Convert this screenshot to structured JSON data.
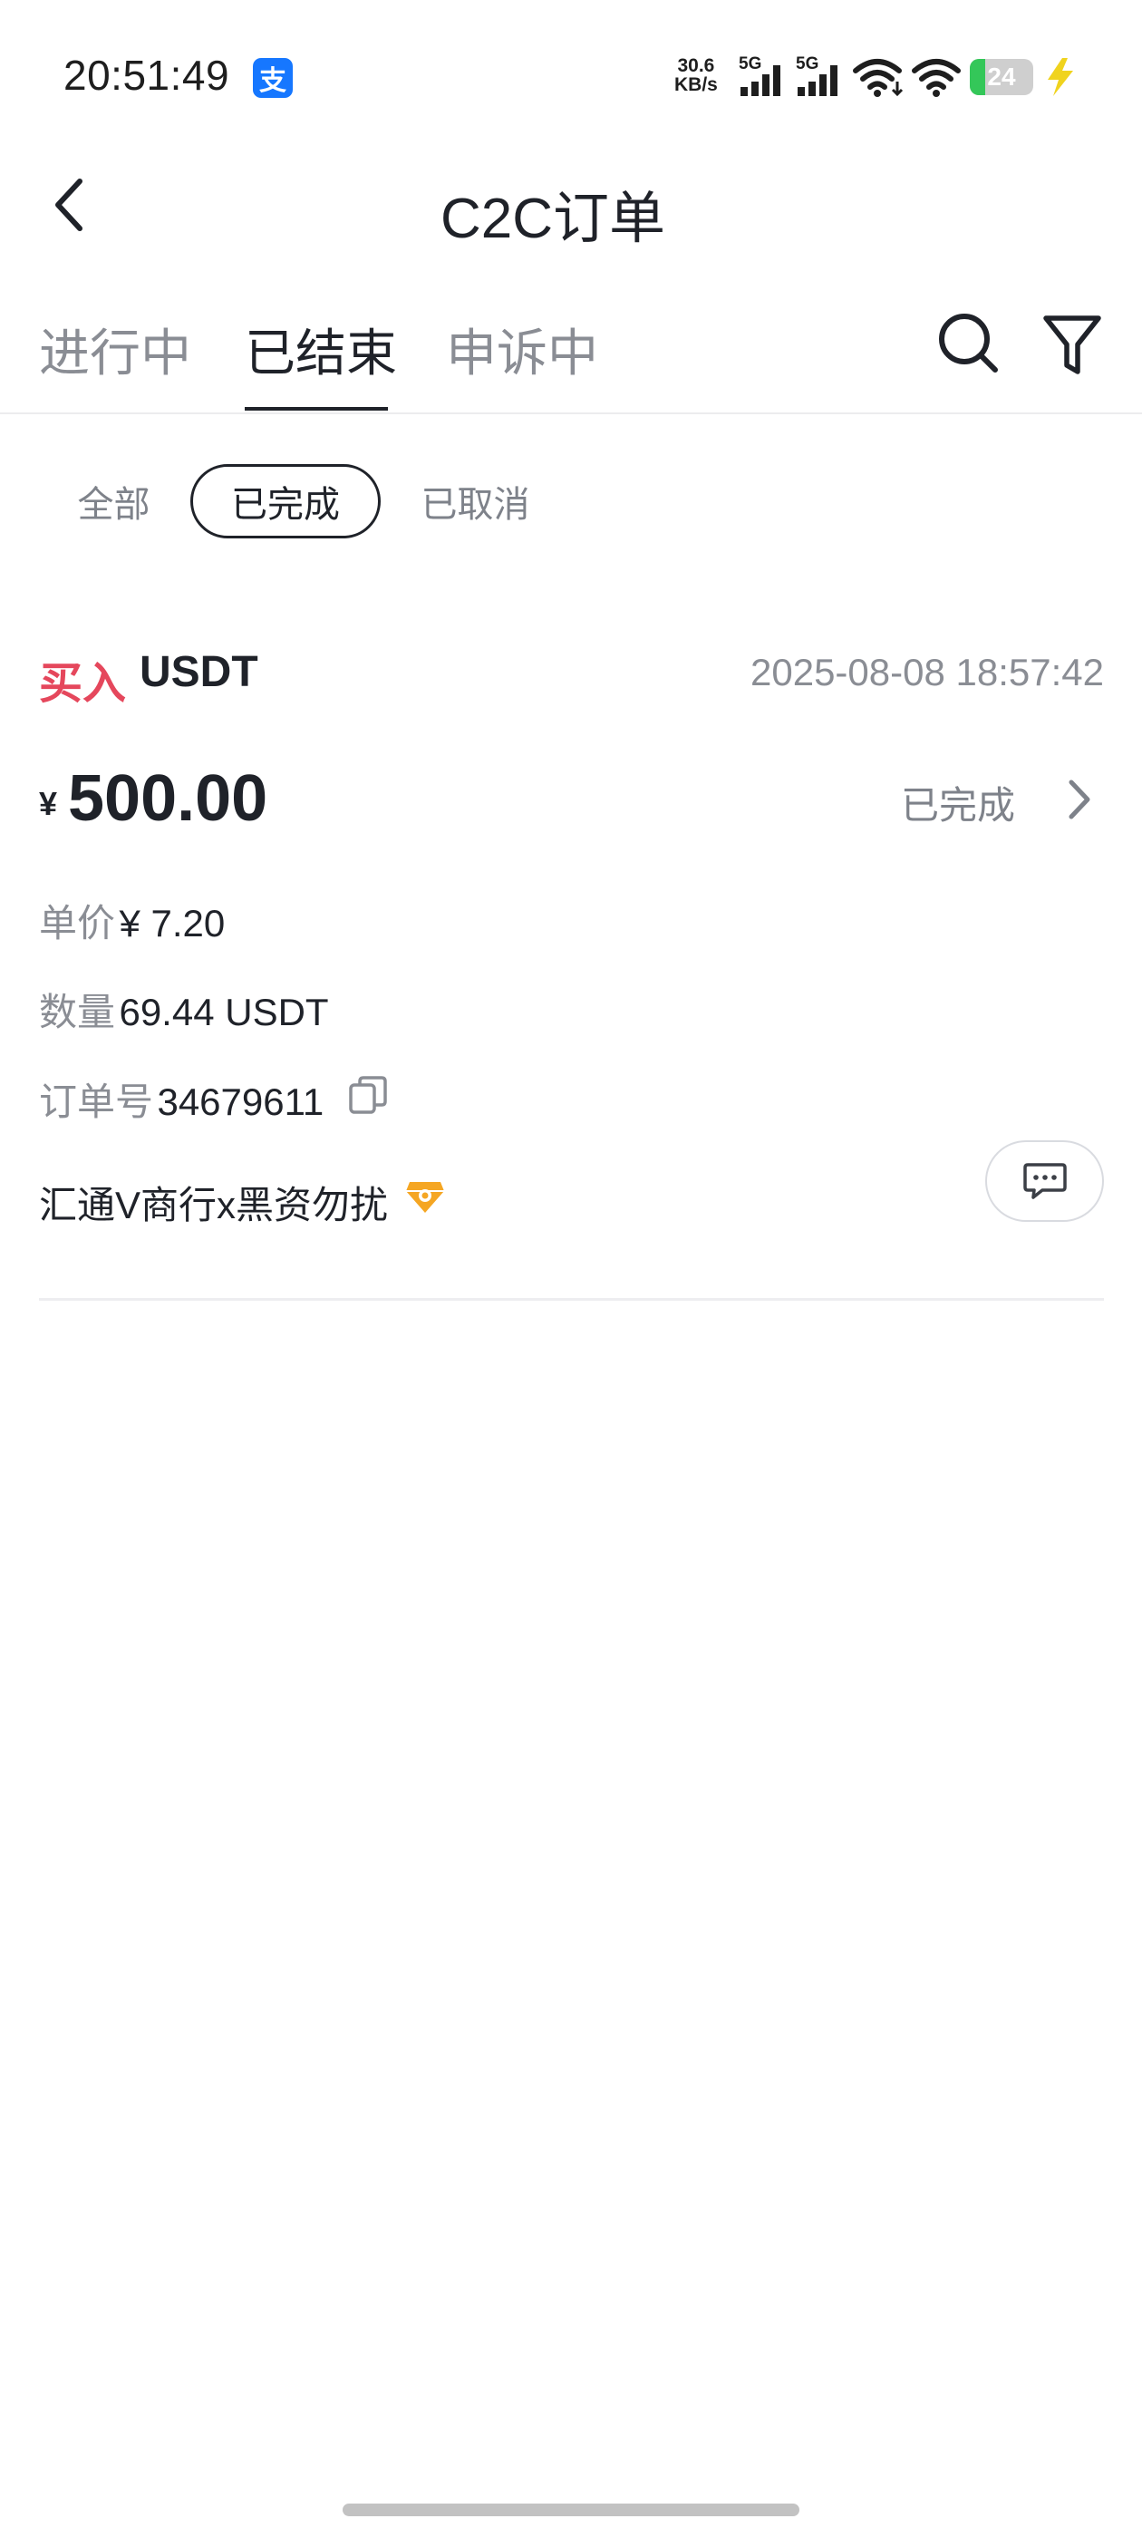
{
  "status_bar": {
    "time": "20:51:49",
    "app_badge_glyph": "支",
    "net_speed_value": "30.6",
    "net_speed_unit": "KB/s",
    "signal_1_label": "5G",
    "signal_2_label": "5G",
    "battery_level": "24",
    "battery_fraction": 0.24,
    "battery_color": "#34c759",
    "charging_icon": "lightning-icon"
  },
  "header": {
    "title": "C2C订单",
    "back_icon": "chevron-left-icon"
  },
  "tabs": {
    "items": [
      {
        "label": "进行中",
        "active": false
      },
      {
        "label": "已结束",
        "active": true
      },
      {
        "label": "申诉中",
        "active": false
      }
    ],
    "search_icon": "search-icon",
    "filter_icon": "filter-icon"
  },
  "subfilters": {
    "items": [
      {
        "label": "全部",
        "selected": false
      },
      {
        "label": "已完成",
        "selected": true
      },
      {
        "label": "已取消",
        "selected": false
      }
    ]
  },
  "order": {
    "side": "买入",
    "side_color": "#e5475c",
    "asset": "USDT",
    "datetime": "2025-08-08 18:57:42",
    "currency_symbol": "¥",
    "total": "500.00",
    "status": "已完成",
    "price_label": "单价",
    "price_value": "¥ 7.20",
    "quantity_label": "数量",
    "quantity_value": "69.44 USDT",
    "order_no_label": "订单号",
    "order_no_value": "34679611",
    "merchant": "汇通V商行x黑资勿扰",
    "merchant_badge_color": "#f5a623"
  }
}
